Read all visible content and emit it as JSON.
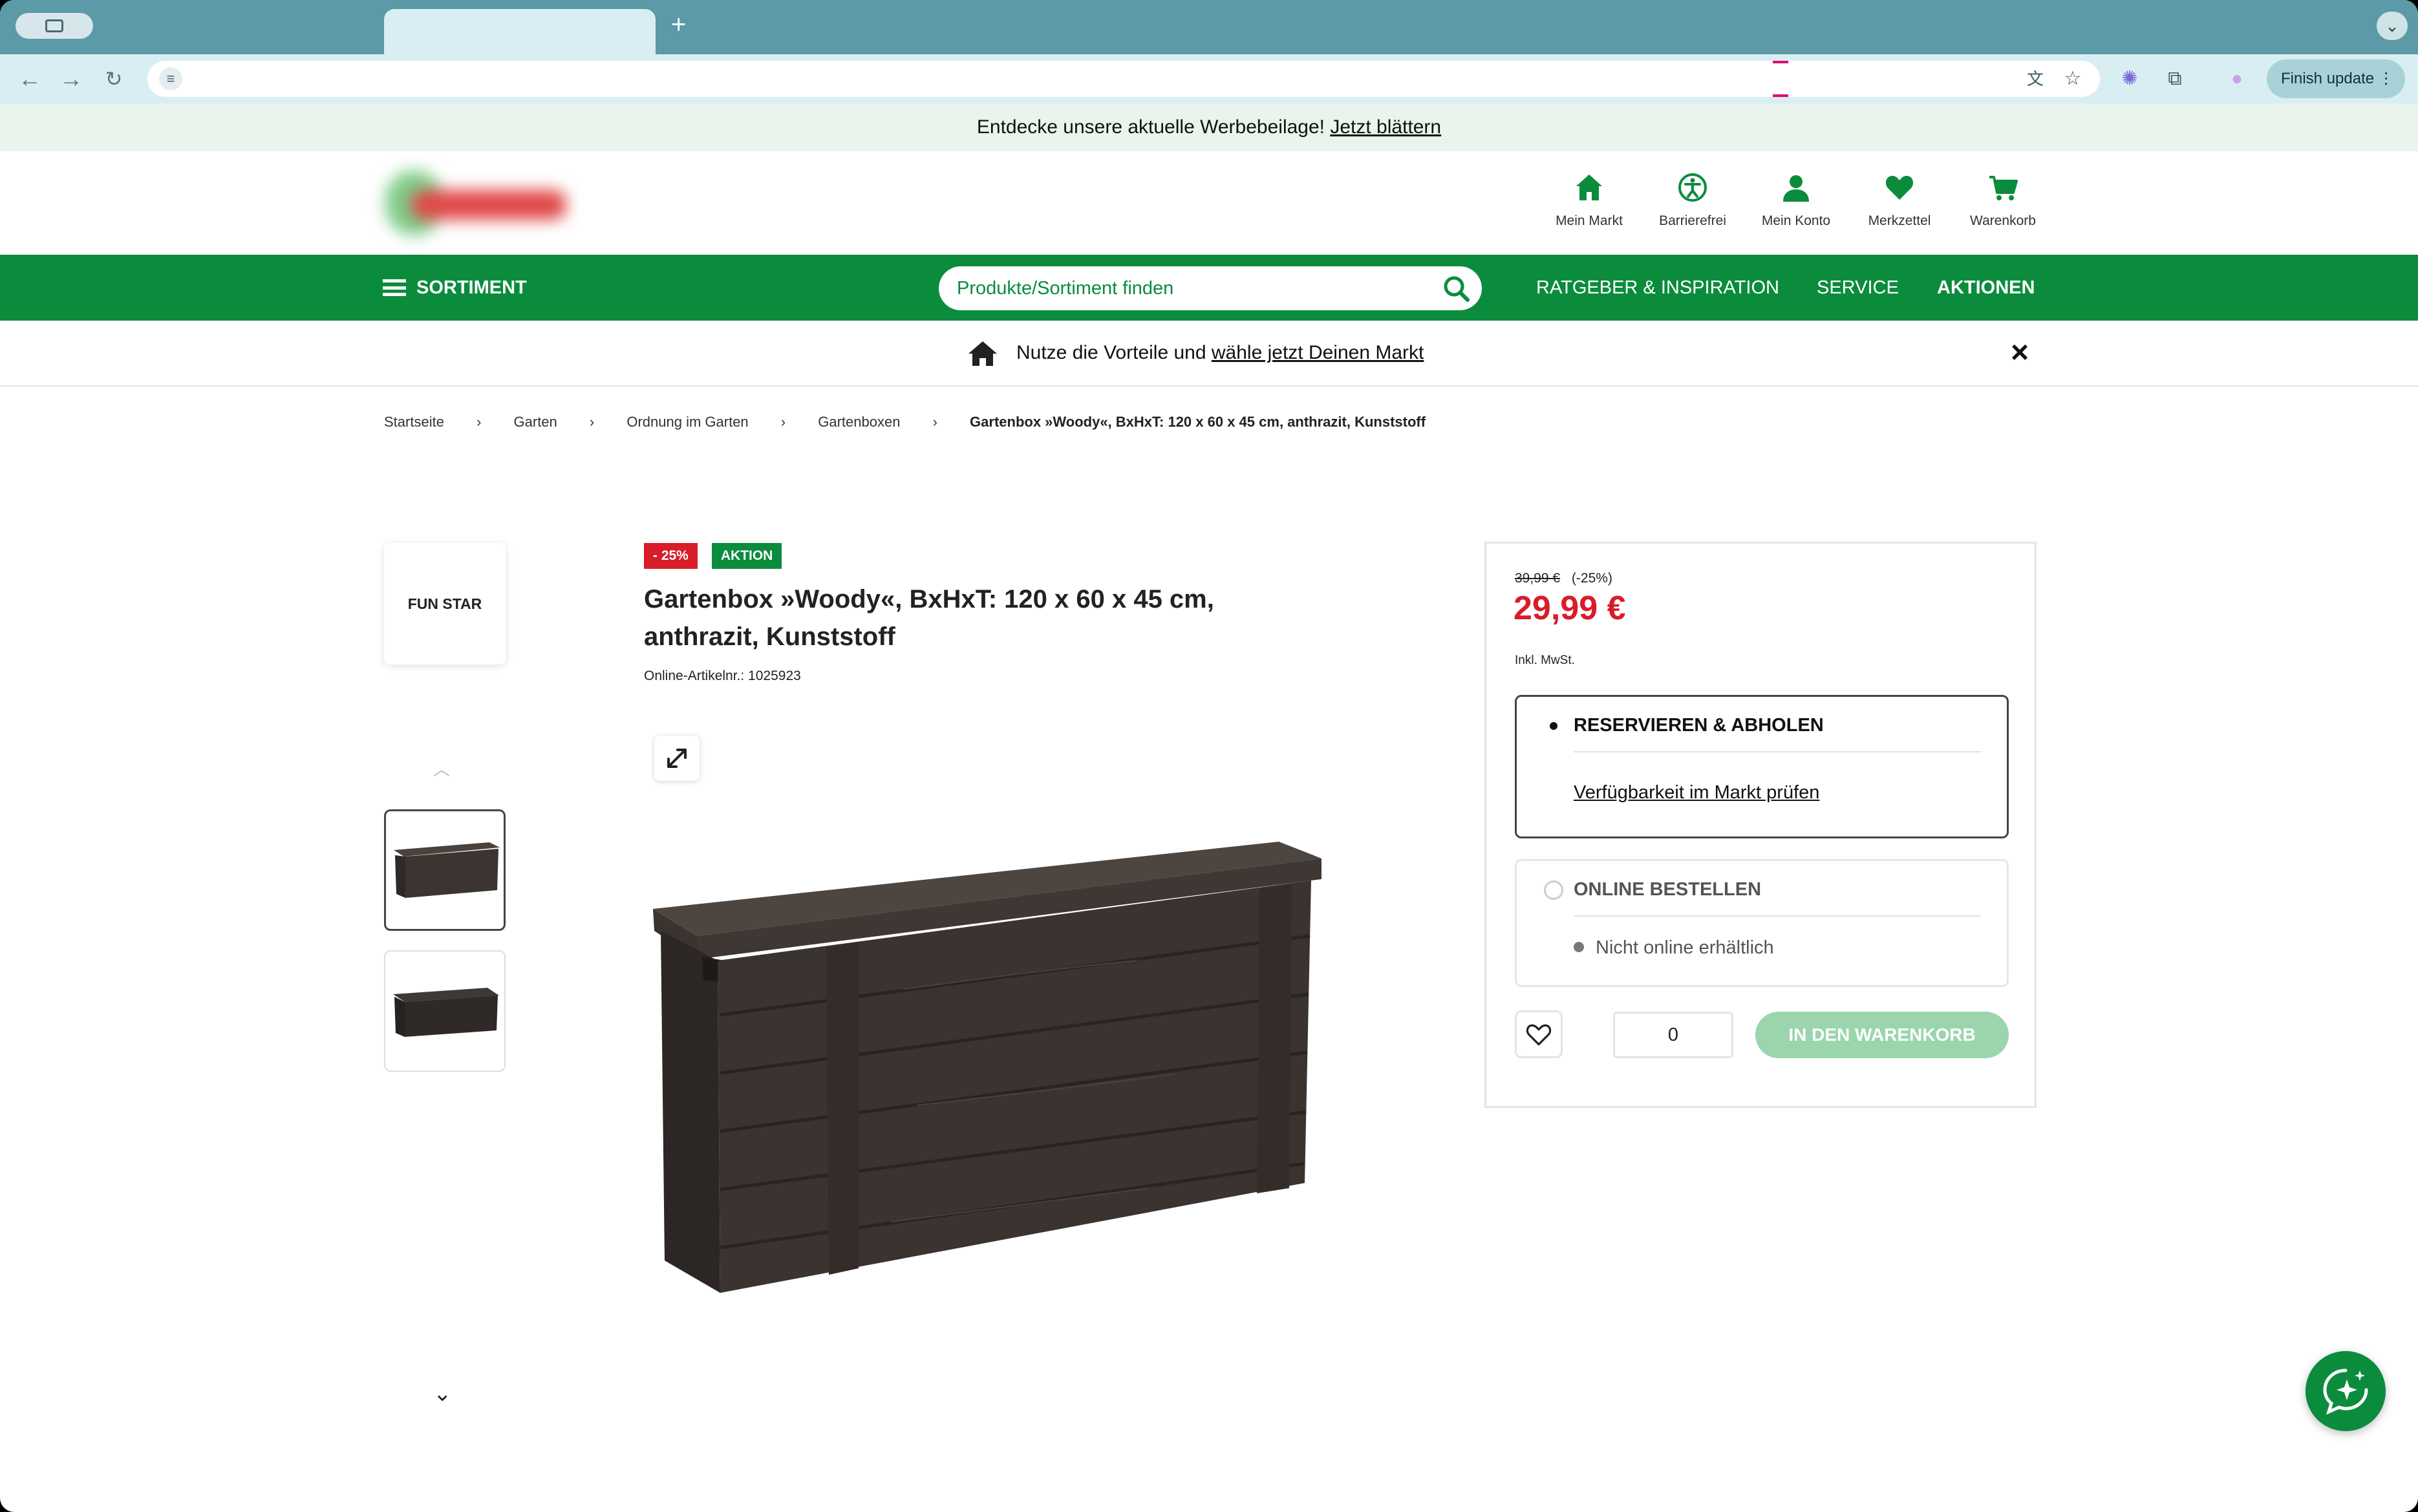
{
  "browser": {
    "new_tab": "+",
    "finish_update": "Finish update ⋮"
  },
  "promo": {
    "text": "Entdecke unsere aktuelle Werbebeilage!",
    "link": "Jetzt blättern"
  },
  "header_nav": {
    "items": [
      {
        "label": "Mein Markt",
        "icon": "home-icon"
      },
      {
        "label": "Barrierefrei",
        "icon": "accessibility-icon"
      },
      {
        "label": "Mein Konto",
        "icon": "user-icon"
      },
      {
        "label": "Merkzettel",
        "icon": "heart-icon"
      },
      {
        "label": "Warenkorb",
        "icon": "cart-icon"
      }
    ]
  },
  "navbar": {
    "sortiment": "SORTIMENT",
    "search_placeholder": "Produkte/Sortiment finden",
    "links": [
      "RATGEBER & INSPIRATION",
      "SERVICE",
      "AKTIONEN"
    ]
  },
  "market_bar": {
    "text": "Nutze die Vorteile und",
    "link": "wähle jetzt Deinen Markt"
  },
  "breadcrumb": [
    "Startseite",
    "Garten",
    "Ordnung im Garten",
    "Gartenboxen",
    "Gartenbox »Woody«, BxHxT: 120 x 60 x 45 cm, anthrazit, Kunststoff"
  ],
  "gallery": {
    "brand": "FUN STAR"
  },
  "product": {
    "badge_discount": "- 25%",
    "badge_aktion": "AKTION",
    "title": "Gartenbox »Woody«, BxHxT: 120 x 60 x 45 cm, anthrazit, Kunststoff",
    "article_no": "Online-Artikelnr.: 1025923"
  },
  "buybox": {
    "old_price": "39,99 €",
    "discount": "(-25%)",
    "price": "29,99 €",
    "vat": "Inkl. MwSt.",
    "option_reserve": "RESERVIEREN & ABHOLEN",
    "availability_link": "Verfügbarkeit im Markt prüfen",
    "option_online": "ONLINE BESTELLEN",
    "online_status": "Nicht online erhältlich",
    "quantity": "0",
    "cart_button": "IN DEN WARENKORB"
  },
  "colors": {
    "brand_green": "#0b8c3d",
    "price_red": "#d91c2a",
    "cart_disabled": "#9ad5ae"
  }
}
